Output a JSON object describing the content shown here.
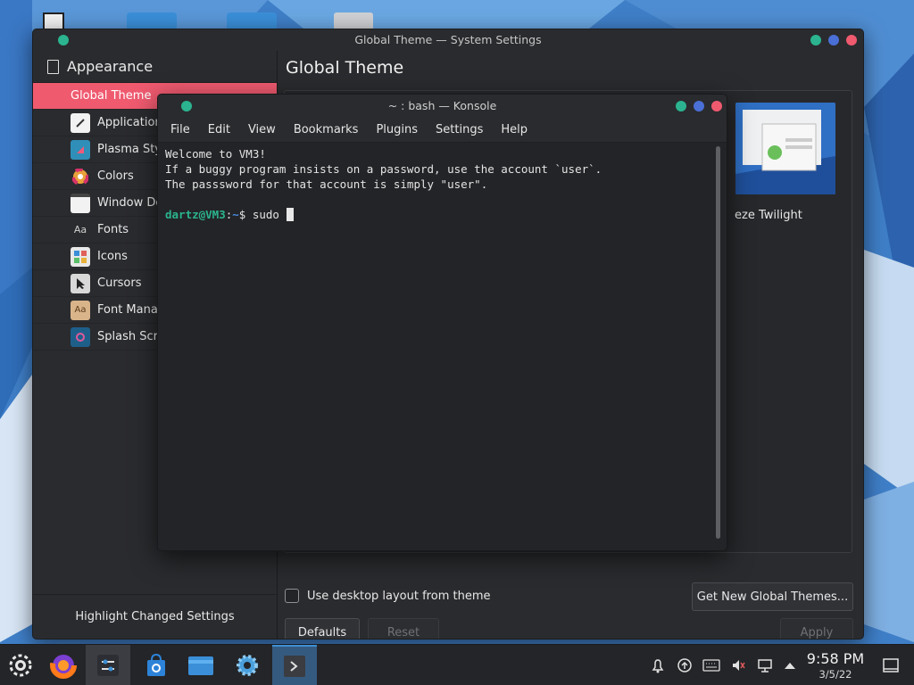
{
  "settings_window": {
    "title": "Global Theme — System Settings",
    "sidebar_header": "Appearance",
    "sidebar_items": [
      {
        "label": "Global Theme",
        "icon": "global-theme-icon"
      },
      {
        "label": "Application",
        "icon": "application-style-icon"
      },
      {
        "label": "Plasma Sty",
        "icon": "plasma-style-icon"
      },
      {
        "label": "Colors",
        "icon": "colors-icon"
      },
      {
        "label": "Window De",
        "icon": "window-decorations-icon"
      },
      {
        "label": "Fonts",
        "icon": "fonts-icon"
      },
      {
        "label": "Icons",
        "icon": "icons-icon"
      },
      {
        "label": "Cursors",
        "icon": "cursors-icon"
      },
      {
        "label": "Font Mana",
        "icon": "font-management-icon"
      },
      {
        "label": "Splash Scre",
        "icon": "splash-screen-icon"
      }
    ],
    "highlight_changed": "Highlight Changed Settings",
    "page_title": "Global Theme",
    "theme_name": "eze Twilight",
    "use_desktop_layout": "Use desktop layout from theme",
    "get_new_themes": "Get New Global Themes...",
    "defaults": "Defaults",
    "reset": "Reset",
    "apply": "Apply"
  },
  "konsole": {
    "title": "~ : bash — Konsole",
    "menu": [
      "File",
      "Edit",
      "View",
      "Bookmarks",
      "Plugins",
      "Settings",
      "Help"
    ],
    "lines": [
      "Welcome to VM3!",
      "If a buggy program insists on a password, use the account `user`.",
      "The passsword for that account is simply \"user\"."
    ],
    "prompt_user": "dartz@VM3",
    "prompt_sep": ":",
    "prompt_path": "~",
    "prompt_symbol": "$ ",
    "command": "sudo "
  },
  "taskbar": {
    "time": "9:58 PM",
    "date": "3/5/22"
  },
  "colors": {
    "accent": "#ef5a6f",
    "window_bg": "#2a2b2e",
    "terminal_bg": "#232427",
    "prompt_user": "#2bb48f",
    "prompt_path": "#4a8be0"
  }
}
